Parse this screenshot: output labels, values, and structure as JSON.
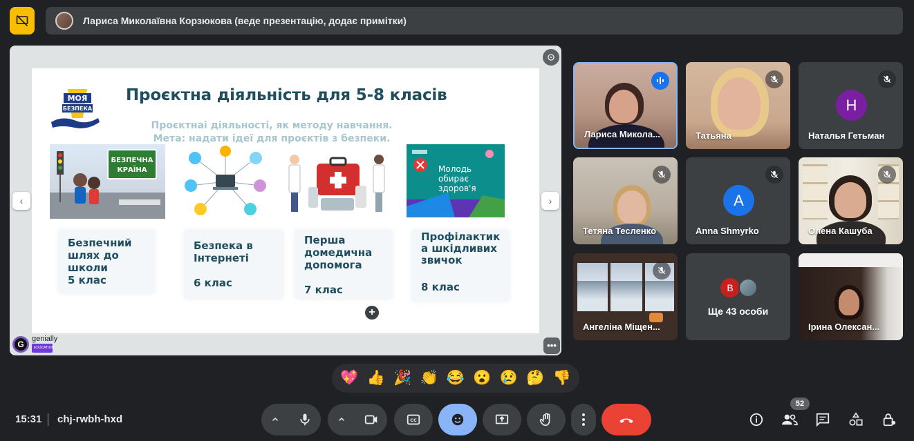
{
  "header": {
    "presenter_banner": "Лариса Миколаївна Корзюкова (веде презентацію, додає примітки)"
  },
  "slide": {
    "logo_line1": "МОЯ",
    "logo_line2": "БЕЗПЕКА",
    "title": "Проєктна діяльність для 5-8 класів",
    "subtitle_line1": "Проєктнаі діяльності, як методу навчання.",
    "subtitle_line2": "Мета: надати ідеї для проєктів з безпеки.",
    "picture1_sign_line1": "БЕЗПЕЧНА",
    "picture1_sign_line2": "КРАЇНА",
    "picture4_text_line1": "Молодь",
    "picture4_text_line2": "обирає",
    "picture4_text_line3": "здоров'я",
    "cards": [
      {
        "title": "Безпечний шлях до школи",
        "grade": "5 клас"
      },
      {
        "title": "Безпека в Інтернеті",
        "grade": "6 клас"
      },
      {
        "title": "Перша домедична допомога",
        "grade": "7 клас"
      },
      {
        "title": "Профілактик а шкідливих звичок",
        "grade": "8 клас"
      }
    ],
    "branding": "genially",
    "branding_sub": "EDUCATION"
  },
  "participants": [
    {
      "name": "Лариса Микола...",
      "state": "speaking"
    },
    {
      "name": "Татьяна",
      "state": "muted"
    },
    {
      "name": "Наталья Гетьман",
      "initial": "Н",
      "avatar_color": "#7b1fa2",
      "state": "muted"
    },
    {
      "name": "Тетяна Тесленко",
      "state": "muted"
    },
    {
      "name": "Anna Shmyrko",
      "initial": "A",
      "avatar_color": "#1a73e8",
      "state": "muted"
    },
    {
      "name": "Олена Кашуба",
      "state": "muted"
    },
    {
      "name": "Ангеліна Міщен...",
      "state": "muted"
    },
    {
      "name": "Ще 43 особи",
      "initial": "В",
      "avatar_color": "#c5221f"
    },
    {
      "name": "Ірина Олексан..."
    }
  ],
  "reactions": [
    "💖",
    "👍",
    "🎉",
    "👏",
    "😂",
    "😮",
    "😢",
    "🤔",
    "👎"
  ],
  "footer": {
    "time": "15:31",
    "meeting_code": "chj-rwbh-hxd",
    "participant_count": "52"
  },
  "colors": {
    "background": "#202124",
    "accent_yellow": "#fbbc04",
    "hangup_red": "#ea4335",
    "active_blue": "#8ab4f8"
  }
}
